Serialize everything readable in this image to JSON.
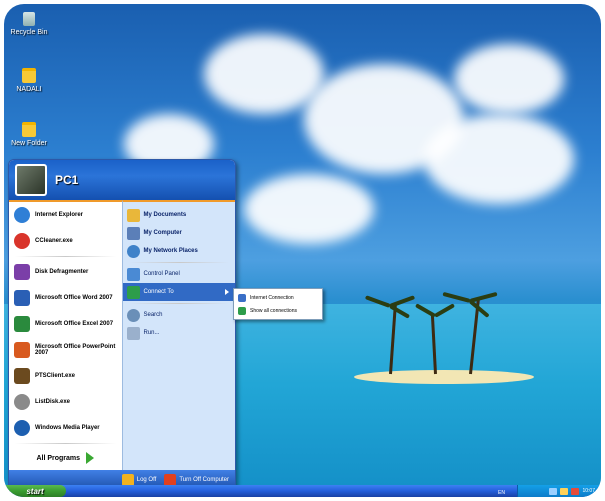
{
  "desktop": {
    "icons": [
      {
        "label": "Recycle Bin",
        "icon": "recycle-bin-icon"
      },
      {
        "label": "NADALI",
        "icon": "folder-icon"
      },
      {
        "label": "New Folder",
        "icon": "folder-icon"
      }
    ]
  },
  "start_menu": {
    "username": "PC1",
    "pinned": [
      {
        "label": "Internet Explorer",
        "icon": "internet-explorer-icon",
        "color": "#2f7fd6"
      },
      {
        "label": "CCleaner.exe",
        "icon": "ccleaner-icon",
        "color": "#d9342b"
      }
    ],
    "recent": [
      {
        "label": "Disk Defragmenter",
        "icon": "disk-defragmenter-icon",
        "color": "#7b3fa8"
      },
      {
        "label": "Microsoft Office Word 2007",
        "icon": "word-icon",
        "color": "#2a5fb5"
      },
      {
        "label": "Microsoft Office Excel 2007",
        "icon": "excel-icon",
        "color": "#2a8a3d"
      },
      {
        "label": "Microsoft Office PowerPoint 2007",
        "icon": "powerpoint-icon",
        "color": "#d85a1f"
      },
      {
        "label": "PTSClient.exe",
        "icon": "ptsclient-icon",
        "color": "#6b4a1f"
      },
      {
        "label": "ListDisk.exe",
        "icon": "listdisk-icon",
        "color": "#8a8a8a"
      },
      {
        "label": "Windows Media Player",
        "icon": "media-player-icon",
        "color": "#1d5fb0"
      }
    ],
    "all_programs": "All Programs",
    "right_items": [
      {
        "label": "My Documents",
        "icon": "my-documents-icon",
        "bold": true,
        "color": "#e9b73a"
      },
      {
        "label": "My Computer",
        "icon": "my-computer-icon",
        "bold": true,
        "color": "#5b7fb8"
      },
      {
        "label": "My Network Places",
        "icon": "network-places-icon",
        "bold": true,
        "color": "#3f82c9"
      },
      {
        "label": "Control Panel",
        "icon": "control-panel-icon",
        "bold": false,
        "color": "#4a8ad4"
      },
      {
        "label": "Connect To",
        "icon": "connect-to-icon",
        "bold": false,
        "color": "#2d9d4a"
      },
      {
        "label": "Search",
        "icon": "search-icon",
        "bold": false,
        "color": "#6a8fb8"
      },
      {
        "label": "Run...",
        "icon": "run-icon",
        "bold": false,
        "color": "#9ab0cc"
      }
    ],
    "footer": {
      "logoff": "Log Off",
      "turnoff": "Turn Off Computer"
    }
  },
  "submenu": {
    "items": [
      {
        "label": "Internet Connection",
        "icon": "internet-connection-icon"
      },
      {
        "label": "Show all connections",
        "icon": "show-connections-icon"
      }
    ]
  },
  "taskbar": {
    "start_label": "start",
    "language": "EN",
    "clock": "10:07"
  },
  "colors": {
    "accent": "#316ac5",
    "start_green": "#3a9d31",
    "taskbar_blue": "#245edb"
  }
}
